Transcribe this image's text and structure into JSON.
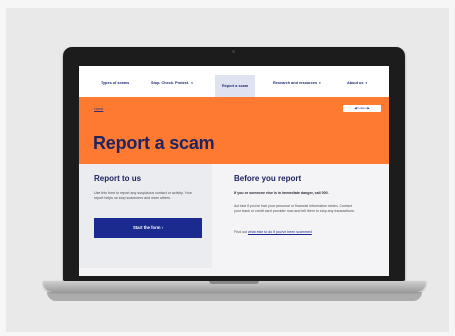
{
  "nav": {
    "items": [
      {
        "label": "Types of scams",
        "chevron": false
      },
      {
        "label": "Stop. Check. Protect.",
        "chevron": true
      },
      {
        "label": "Report a scam",
        "chevron": false
      },
      {
        "label": "Research and resources",
        "chevron": true
      },
      {
        "label": "About us",
        "chevron": true
      }
    ],
    "active": "Report a scam",
    "chevron_glyph": "▾"
  },
  "hero": {
    "breadcrumb": "Home",
    "listen_label": "◀) Listen ▶",
    "title": "Report a scam",
    "color": "#ff7a31"
  },
  "left": {
    "title": "Report to us",
    "body": "Use this form to report any suspicious contact or activity. Your report helps us stop scammers and warn others.",
    "button_label": "Start the form ›"
  },
  "right": {
    "title": "Before you report",
    "danger": "If you or someone else is in immediate danger, call 000.",
    "body": "Act fast if you've had your personal or financial information stolen. Contact your bank or credit card provider now and tell them to stop any transactions.",
    "find_prefix": "Find out ",
    "find_link": "what else to do if you've been scammed"
  },
  "colors": {
    "brand_navy": "#1a2a8f",
    "hero_orange": "#ff7a31"
  }
}
